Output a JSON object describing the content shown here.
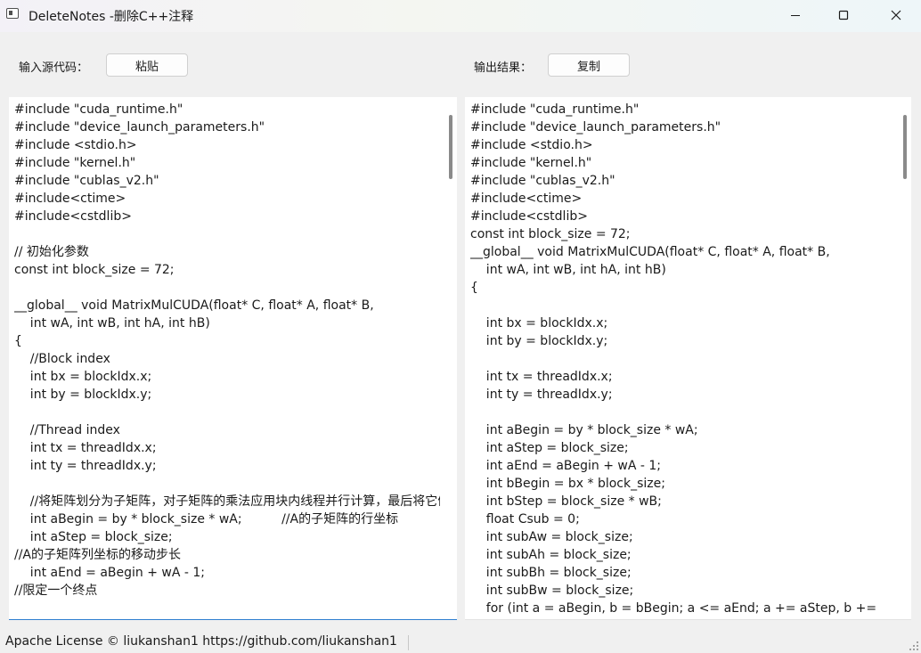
{
  "window": {
    "title": "DeleteNotes -删除C++注释",
    "icon": "app-window-icon",
    "controls": [
      "minimize-icon",
      "maximize-icon",
      "close-icon"
    ]
  },
  "input_section": {
    "label": "输入源代码：",
    "paste_button": "粘贴"
  },
  "output_section": {
    "label": "输出结果：",
    "copy_button": "复制"
  },
  "source_lines": [
    "#include \"cuda_runtime.h\"",
    "#include \"device_launch_parameters.h\"",
    "#include <stdio.h>",
    "#include \"kernel.h\"",
    "#include \"cublas_v2.h\"",
    "#include<ctime>",
    "#include<cstdlib>",
    "",
    "// 初始化参数",
    "const int block_size = 72;",
    "",
    "__global__ void MatrixMulCUDA(float* C, float* A, float* B,",
    "    int wA, int wB, int hA, int hB)",
    "{",
    "    //Block index",
    "    int bx = blockIdx.x;",
    "    int by = blockIdx.y;",
    "",
    "    //Thread index",
    "    int tx = threadIdx.x;",
    "    int ty = threadIdx.y;",
    "",
    "    //将矩阵划分为子矩阵，对子矩阵的乘法应用块内线程并行计算，最后将它们的值相加得到C的一个元素值",
    "    int aBegin = by * block_size * wA;          //A的子矩阵的行坐标",
    "    int aStep = block_size;",
    "//A的子矩阵列坐标的移动步长",
    "    int aEnd = aBegin + wA - 1;",
    "//限定一个终点"
  ],
  "output_lines": [
    "#include \"cuda_runtime.h\"",
    "#include \"device_launch_parameters.h\"",
    "#include <stdio.h>",
    "#include \"kernel.h\"",
    "#include \"cublas_v2.h\"",
    "#include<ctime>",
    "#include<cstdlib>",
    "const int block_size = 72;",
    "__global__ void MatrixMulCUDA(float* C, float* A, float* B,",
    "    int wA, int wB, int hA, int hB)",
    "{",
    "",
    "    int bx = blockIdx.x;",
    "    int by = blockIdx.y;",
    "",
    "    int tx = threadIdx.x;",
    "    int ty = threadIdx.y;",
    "",
    "    int aBegin = by * block_size * wA;",
    "    int aStep = block_size;",
    "    int aEnd = aBegin + wA - 1;",
    "    int bBegin = bx * block_size;",
    "    int bStep = block_size * wB;",
    "    float Csub = 0;",
    "    int subAw = block_size;",
    "    int subAh = block_size;",
    "    int subBh = block_size;",
    "    int subBw = block_size;",
    "    for (int a = aBegin, b = bBegin; a <= aEnd; a += aStep, b += "
  ],
  "status": {
    "text": "Apache License © liukanshan1 https://github.com/liukanshan1"
  },
  "colors": {
    "focus_accent": "#2f7fd0",
    "background": "#f0f0f0"
  }
}
